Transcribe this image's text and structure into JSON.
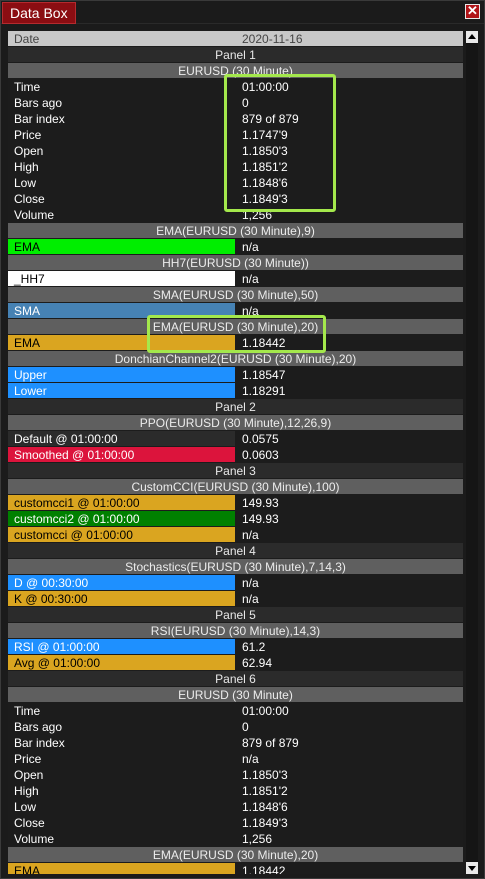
{
  "window": {
    "title": "Data Box",
    "close_symbol": "✕"
  },
  "date_row": {
    "label": "Date",
    "value": "2020-11-16"
  },
  "rows": [
    {
      "type": "panel",
      "text": "Panel 1"
    },
    {
      "type": "ind",
      "text": "EURUSD (30 Minute)"
    },
    {
      "type": "data",
      "label": "Time",
      "value": "01:00:00"
    },
    {
      "type": "data",
      "label": "Bars ago",
      "value": "0"
    },
    {
      "type": "data",
      "label": "Bar index",
      "value": "879 of 879"
    },
    {
      "type": "data",
      "label": "Price",
      "value": "1.1747'9"
    },
    {
      "type": "data",
      "label": "Open",
      "value": "1.1850'3"
    },
    {
      "type": "data",
      "label": "High",
      "value": "1.1851'2"
    },
    {
      "type": "data",
      "label": "Low",
      "value": "1.1848'6"
    },
    {
      "type": "data",
      "label": "Close",
      "value": "1.1849'3"
    },
    {
      "type": "data",
      "label": "Volume",
      "value": "1,256"
    },
    {
      "type": "ind",
      "text": "EMA(EURUSD (30 Minute),9)"
    },
    {
      "type": "data",
      "label": "EMA",
      "value": "n/a",
      "bg": "#00ee00",
      "fg": "#000000"
    },
    {
      "type": "ind",
      "text": "HH7(EURUSD (30 Minute))"
    },
    {
      "type": "data",
      "label": "_HH7",
      "value": "n/a",
      "bg": "#ffffff",
      "fg": "#000000"
    },
    {
      "type": "ind",
      "text": "SMA(EURUSD (30 Minute),50)"
    },
    {
      "type": "data",
      "label": "SMA",
      "value": "n/a",
      "bg": "#4682b4",
      "fg": "#ffffff"
    },
    {
      "type": "ind",
      "text": "EMA(EURUSD (30 Minute),20)"
    },
    {
      "type": "data",
      "label": "EMA",
      "value": "1.18442",
      "bg": "#daa520",
      "fg": "#000000"
    },
    {
      "type": "ind",
      "text": "DonchianChannel2(EURUSD (30 Minute),20)"
    },
    {
      "type": "data",
      "label": "Upper",
      "value": "1.18547",
      "bg": "#1e90ff",
      "fg": "#ffffff"
    },
    {
      "type": "data",
      "label": "Lower",
      "value": "1.18291",
      "bg": "#1e90ff",
      "fg": "#ffffff"
    },
    {
      "type": "panel",
      "text": "Panel 2"
    },
    {
      "type": "ind",
      "text": "PPO(EURUSD (30 Minute),12,26,9)"
    },
    {
      "type": "data",
      "label": "Default @ 01:00:00",
      "value": "0.0575",
      "bg": "#2b2b2b",
      "fg": "#ffffff"
    },
    {
      "type": "data",
      "label": "Smoothed @ 01:00:00",
      "value": "0.0603",
      "bg": "#dc143c",
      "fg": "#ffffff"
    },
    {
      "type": "panel",
      "text": "Panel 3"
    },
    {
      "type": "ind",
      "text": "CustomCCI(EURUSD (30 Minute),100)"
    },
    {
      "type": "data",
      "label": "customcci1 @ 01:00:00",
      "value": "149.93",
      "bg": "#daa520",
      "fg": "#000000"
    },
    {
      "type": "data",
      "label": "customcci2 @ 01:00:00",
      "value": "149.93",
      "bg": "#008000",
      "fg": "#ffffff"
    },
    {
      "type": "data",
      "label": "customcci @ 01:00:00",
      "value": "n/a",
      "bg": "#daa520",
      "fg": "#000000"
    },
    {
      "type": "panel",
      "text": "Panel 4"
    },
    {
      "type": "ind",
      "text": "Stochastics(EURUSD (30 Minute),7,14,3)"
    },
    {
      "type": "data",
      "label": "D @ 00:30:00",
      "value": "n/a",
      "bg": "#1e90ff",
      "fg": "#ffffff"
    },
    {
      "type": "data",
      "label": "K @ 00:30:00",
      "value": "n/a",
      "bg": "#daa520",
      "fg": "#000000"
    },
    {
      "type": "panel",
      "text": "Panel 5"
    },
    {
      "type": "ind",
      "text": "RSI(EURUSD (30 Minute),14,3)"
    },
    {
      "type": "data",
      "label": "RSI @ 01:00:00",
      "value": "61.2",
      "bg": "#1e90ff",
      "fg": "#ffffff"
    },
    {
      "type": "data",
      "label": "Avg @ 01:00:00",
      "value": "62.94",
      "bg": "#daa520",
      "fg": "#000000"
    },
    {
      "type": "panel",
      "text": "Panel 6"
    },
    {
      "type": "ind",
      "text": "EURUSD (30 Minute)"
    },
    {
      "type": "data",
      "label": "Time",
      "value": "01:00:00"
    },
    {
      "type": "data",
      "label": "Bars ago",
      "value": "0"
    },
    {
      "type": "data",
      "label": "Bar index",
      "value": "879 of 879"
    },
    {
      "type": "data",
      "label": "Price",
      "value": "n/a"
    },
    {
      "type": "data",
      "label": "Open",
      "value": "1.1850'3"
    },
    {
      "type": "data",
      "label": "High",
      "value": "1.1851'2"
    },
    {
      "type": "data",
      "label": "Low",
      "value": "1.1848'6"
    },
    {
      "type": "data",
      "label": "Close",
      "value": "1.1849'3"
    },
    {
      "type": "data",
      "label": "Volume",
      "value": "1,256"
    },
    {
      "type": "ind",
      "text": "EMA(EURUSD (30 Minute),20)"
    },
    {
      "type": "data",
      "label": "EMA",
      "value": "1.18442",
      "bg": "#daa520",
      "fg": "#000000"
    }
  ],
  "colors": {
    "highlight": "#a4e84c",
    "title_tab": "#8b0d12"
  }
}
